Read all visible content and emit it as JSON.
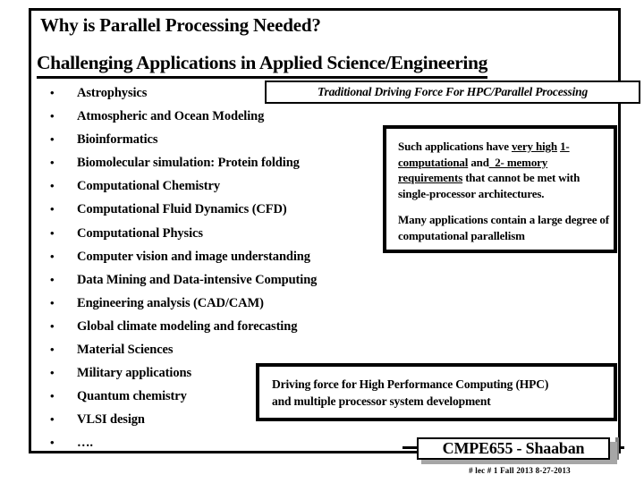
{
  "slide": {
    "title": "Why is Parallel Processing Needed?",
    "subtitle": "Challenging Applications in Applied Science/Engineering"
  },
  "bullets": {
    "marker": "•",
    "items": [
      "Astrophysics",
      "Atmospheric and Ocean Modeling",
      "Bioinformatics",
      "Biomolecular simulation: Protein folding",
      "Computational Chemistry",
      "Computational Fluid Dynamics (CFD)",
      "Computational Physics",
      "Computer vision and image understanding",
      "Data Mining and Data-intensive Computing",
      "Engineering analysis (CAD/CAM)",
      "Global climate modeling and forecasting",
      "Material Sciences",
      "Military applications",
      "Quantum chemistry",
      "VLSI design",
      "…."
    ]
  },
  "callouts": {
    "traditional": {
      "text": "Traditional Driving Force For HPC/Parallel Processing"
    },
    "requirements": {
      "p1_part1": "Such applications have ",
      "p1_underline1": "very high",
      "p1_underline2": "1- computational",
      "p1_part2": " and",
      "p1_underline3": "_2- memory requirements",
      "p1_part3": " that cannot be met with single-processor architectures.",
      "p2": "Many applications contain a large degree of computational parallelism"
    },
    "driving": {
      "line1": "Driving force for High Performance Computing (HPC)",
      "line2": "and multiple processor system development"
    }
  },
  "footer": {
    "course": "CMPE655 - Shaaban",
    "meta": "#  lec # 1    Fall 2013   8-27-2013"
  },
  "colors": {
    "ink": "#000000",
    "paper": "#ffffff",
    "shadow": "#a6a6a6"
  }
}
